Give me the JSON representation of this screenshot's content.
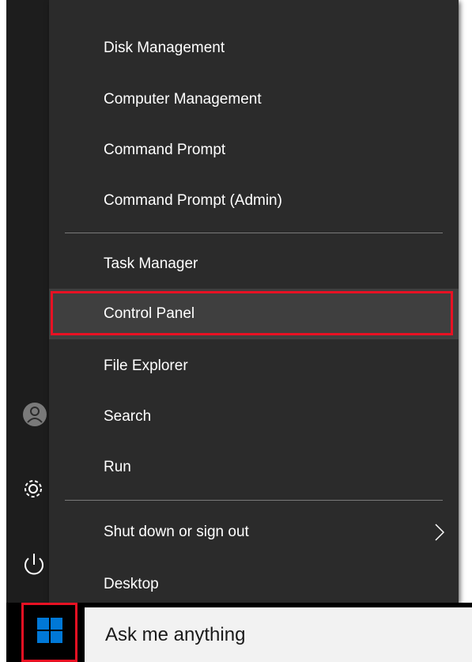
{
  "context_menu": {
    "items": [
      {
        "label": "Disk Management"
      },
      {
        "label": "Computer Management"
      },
      {
        "label": "Command Prompt"
      },
      {
        "label": "Command Prompt (Admin)"
      },
      {
        "label": "Task Manager"
      },
      {
        "label": "Control Panel",
        "highlighted": true
      },
      {
        "label": "File Explorer"
      },
      {
        "label": "Search"
      },
      {
        "label": "Run"
      },
      {
        "label": "Shut down or sign out",
        "has_submenu": true
      },
      {
        "label": "Desktop"
      }
    ]
  },
  "taskbar": {
    "search_placeholder": "Ask me anything"
  },
  "colors": {
    "menu_bg": "#2b2b2b",
    "menu_highlight": "#3f3f3f",
    "annotation_red": "#e81123",
    "windows_logo_blue": "#0078d7"
  },
  "icons": [
    "user-icon",
    "settings-icon",
    "power-icon",
    "windows-logo-icon",
    "chevron-right-icon"
  ]
}
